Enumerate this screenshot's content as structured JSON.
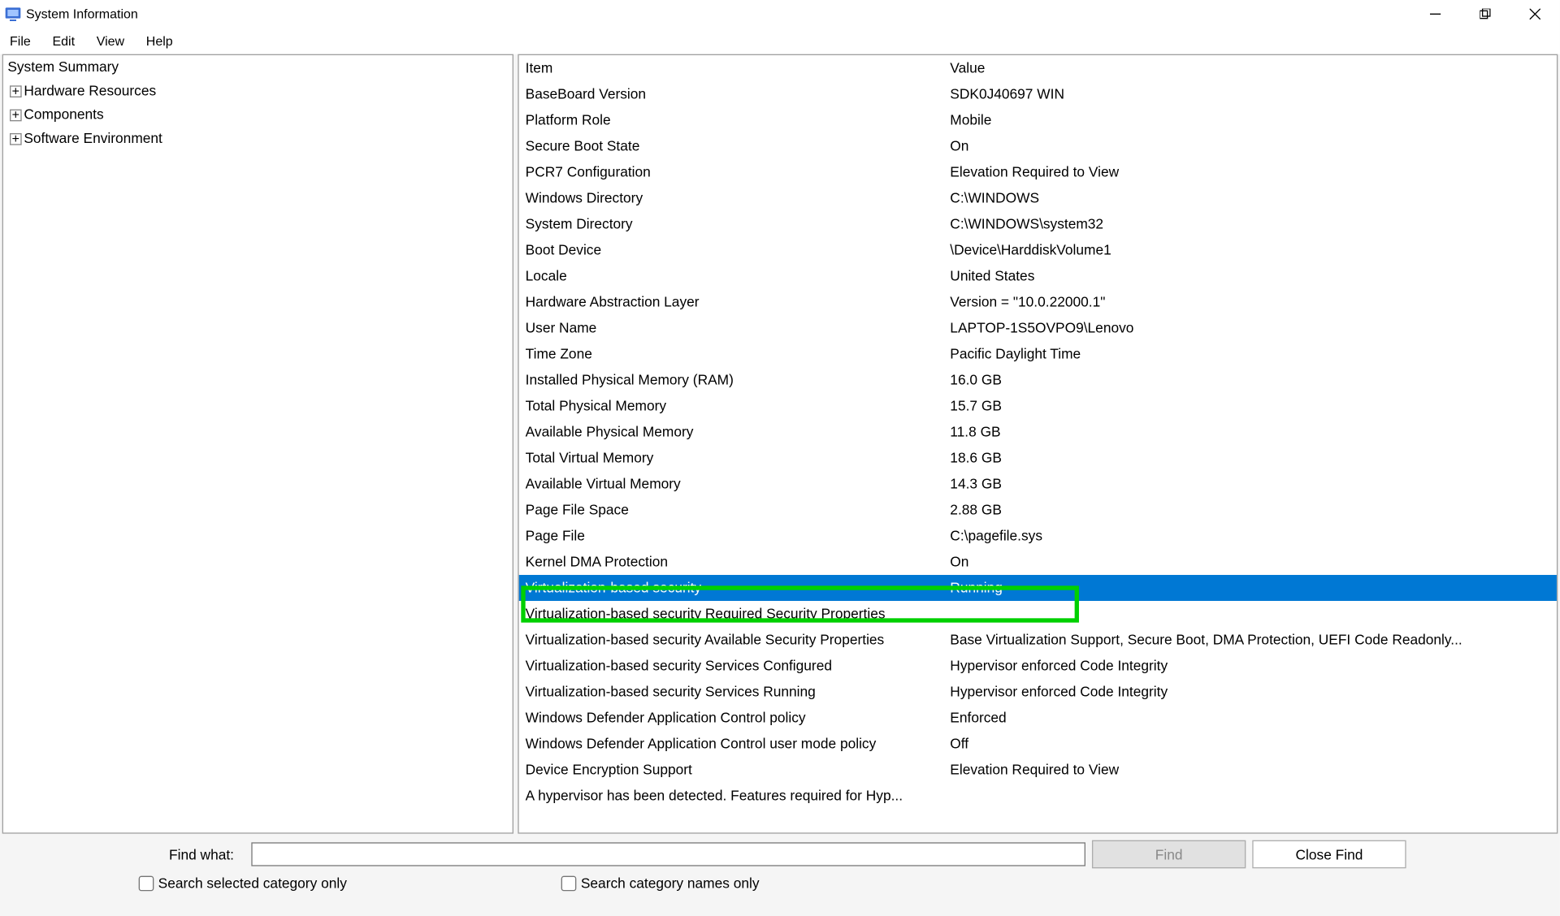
{
  "window": {
    "title": "System Information"
  },
  "menu": {
    "file": "File",
    "edit": "Edit",
    "view": "View",
    "help": "Help"
  },
  "tree": {
    "root": "System Summary",
    "items": [
      "Hardware Resources",
      "Components",
      "Software Environment"
    ]
  },
  "details": {
    "header_item": "Item",
    "header_value": "Value",
    "rows": [
      {
        "item": "BaseBoard Version",
        "value": "SDK0J40697 WIN"
      },
      {
        "item": "Platform Role",
        "value": "Mobile"
      },
      {
        "item": "Secure Boot State",
        "value": "On"
      },
      {
        "item": "PCR7 Configuration",
        "value": "Elevation Required to View"
      },
      {
        "item": "Windows Directory",
        "value": "C:\\WINDOWS"
      },
      {
        "item": "System Directory",
        "value": "C:\\WINDOWS\\system32"
      },
      {
        "item": "Boot Device",
        "value": "\\Device\\HarddiskVolume1"
      },
      {
        "item": "Locale",
        "value": "United States"
      },
      {
        "item": "Hardware Abstraction Layer",
        "value": "Version = \"10.0.22000.1\""
      },
      {
        "item": "User Name",
        "value": "LAPTOP-1S5OVPO9\\Lenovo"
      },
      {
        "item": "Time Zone",
        "value": "Pacific Daylight Time"
      },
      {
        "item": "Installed Physical Memory (RAM)",
        "value": "16.0 GB"
      },
      {
        "item": "Total Physical Memory",
        "value": "15.7 GB"
      },
      {
        "item": "Available Physical Memory",
        "value": "11.8 GB"
      },
      {
        "item": "Total Virtual Memory",
        "value": "18.6 GB"
      },
      {
        "item": "Available Virtual Memory",
        "value": "14.3 GB"
      },
      {
        "item": "Page File Space",
        "value": "2.88 GB"
      },
      {
        "item": "Page File",
        "value": "C:\\pagefile.sys"
      },
      {
        "item": "Kernel DMA Protection",
        "value": "On"
      },
      {
        "item": "Virtualization-based security",
        "value": "Running",
        "selected": true
      },
      {
        "item": "Virtualization-based security Required Security Properties",
        "value": ""
      },
      {
        "item": "Virtualization-based security Available Security Properties",
        "value": "Base Virtualization Support, Secure Boot, DMA Protection, UEFI Code Readonly..."
      },
      {
        "item": "Virtualization-based security Services Configured",
        "value": "Hypervisor enforced Code Integrity"
      },
      {
        "item": "Virtualization-based security Services Running",
        "value": "Hypervisor enforced Code Integrity"
      },
      {
        "item": "Windows Defender Application Control policy",
        "value": "Enforced"
      },
      {
        "item": "Windows Defender Application Control user mode policy",
        "value": "Off"
      },
      {
        "item": "Device Encryption Support",
        "value": "Elevation Required to View"
      },
      {
        "item": "A hypervisor has been detected. Features required for Hyp...",
        "value": ""
      }
    ]
  },
  "footer": {
    "find_label": "Find what:",
    "find_btn": "Find",
    "close_find_btn": "Close Find",
    "check1": "Search selected category only",
    "check2": "Search category names only"
  }
}
